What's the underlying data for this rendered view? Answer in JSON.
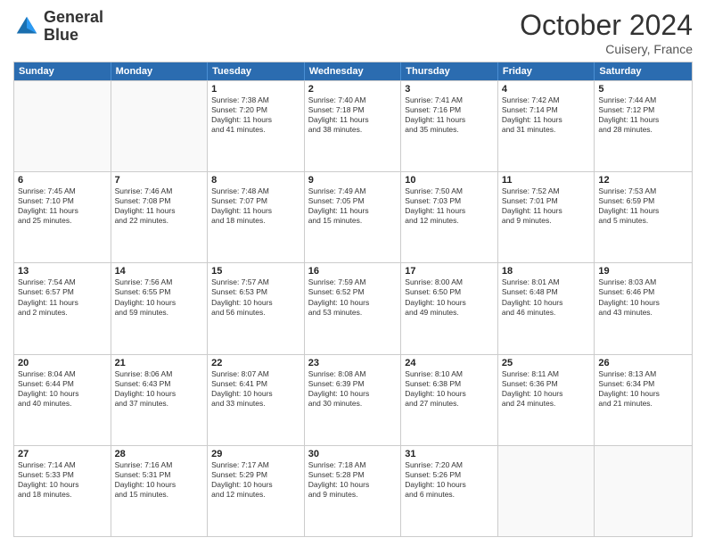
{
  "header": {
    "logo_line1": "General",
    "logo_line2": "Blue",
    "month": "October 2024",
    "location": "Cuisery, France"
  },
  "days_of_week": [
    "Sunday",
    "Monday",
    "Tuesday",
    "Wednesday",
    "Thursday",
    "Friday",
    "Saturday"
  ],
  "weeks": [
    [
      {
        "day": "",
        "lines": []
      },
      {
        "day": "",
        "lines": []
      },
      {
        "day": "1",
        "lines": [
          "Sunrise: 7:38 AM",
          "Sunset: 7:20 PM",
          "Daylight: 11 hours",
          "and 41 minutes."
        ]
      },
      {
        "day": "2",
        "lines": [
          "Sunrise: 7:40 AM",
          "Sunset: 7:18 PM",
          "Daylight: 11 hours",
          "and 38 minutes."
        ]
      },
      {
        "day": "3",
        "lines": [
          "Sunrise: 7:41 AM",
          "Sunset: 7:16 PM",
          "Daylight: 11 hours",
          "and 35 minutes."
        ]
      },
      {
        "day": "4",
        "lines": [
          "Sunrise: 7:42 AM",
          "Sunset: 7:14 PM",
          "Daylight: 11 hours",
          "and 31 minutes."
        ]
      },
      {
        "day": "5",
        "lines": [
          "Sunrise: 7:44 AM",
          "Sunset: 7:12 PM",
          "Daylight: 11 hours",
          "and 28 minutes."
        ]
      }
    ],
    [
      {
        "day": "6",
        "lines": [
          "Sunrise: 7:45 AM",
          "Sunset: 7:10 PM",
          "Daylight: 11 hours",
          "and 25 minutes."
        ]
      },
      {
        "day": "7",
        "lines": [
          "Sunrise: 7:46 AM",
          "Sunset: 7:08 PM",
          "Daylight: 11 hours",
          "and 22 minutes."
        ]
      },
      {
        "day": "8",
        "lines": [
          "Sunrise: 7:48 AM",
          "Sunset: 7:07 PM",
          "Daylight: 11 hours",
          "and 18 minutes."
        ]
      },
      {
        "day": "9",
        "lines": [
          "Sunrise: 7:49 AM",
          "Sunset: 7:05 PM",
          "Daylight: 11 hours",
          "and 15 minutes."
        ]
      },
      {
        "day": "10",
        "lines": [
          "Sunrise: 7:50 AM",
          "Sunset: 7:03 PM",
          "Daylight: 11 hours",
          "and 12 minutes."
        ]
      },
      {
        "day": "11",
        "lines": [
          "Sunrise: 7:52 AM",
          "Sunset: 7:01 PM",
          "Daylight: 11 hours",
          "and 9 minutes."
        ]
      },
      {
        "day": "12",
        "lines": [
          "Sunrise: 7:53 AM",
          "Sunset: 6:59 PM",
          "Daylight: 11 hours",
          "and 5 minutes."
        ]
      }
    ],
    [
      {
        "day": "13",
        "lines": [
          "Sunrise: 7:54 AM",
          "Sunset: 6:57 PM",
          "Daylight: 11 hours",
          "and 2 minutes."
        ]
      },
      {
        "day": "14",
        "lines": [
          "Sunrise: 7:56 AM",
          "Sunset: 6:55 PM",
          "Daylight: 10 hours",
          "and 59 minutes."
        ]
      },
      {
        "day": "15",
        "lines": [
          "Sunrise: 7:57 AM",
          "Sunset: 6:53 PM",
          "Daylight: 10 hours",
          "and 56 minutes."
        ]
      },
      {
        "day": "16",
        "lines": [
          "Sunrise: 7:59 AM",
          "Sunset: 6:52 PM",
          "Daylight: 10 hours",
          "and 53 minutes."
        ]
      },
      {
        "day": "17",
        "lines": [
          "Sunrise: 8:00 AM",
          "Sunset: 6:50 PM",
          "Daylight: 10 hours",
          "and 49 minutes."
        ]
      },
      {
        "day": "18",
        "lines": [
          "Sunrise: 8:01 AM",
          "Sunset: 6:48 PM",
          "Daylight: 10 hours",
          "and 46 minutes."
        ]
      },
      {
        "day": "19",
        "lines": [
          "Sunrise: 8:03 AM",
          "Sunset: 6:46 PM",
          "Daylight: 10 hours",
          "and 43 minutes."
        ]
      }
    ],
    [
      {
        "day": "20",
        "lines": [
          "Sunrise: 8:04 AM",
          "Sunset: 6:44 PM",
          "Daylight: 10 hours",
          "and 40 minutes."
        ]
      },
      {
        "day": "21",
        "lines": [
          "Sunrise: 8:06 AM",
          "Sunset: 6:43 PM",
          "Daylight: 10 hours",
          "and 37 minutes."
        ]
      },
      {
        "day": "22",
        "lines": [
          "Sunrise: 8:07 AM",
          "Sunset: 6:41 PM",
          "Daylight: 10 hours",
          "and 33 minutes."
        ]
      },
      {
        "day": "23",
        "lines": [
          "Sunrise: 8:08 AM",
          "Sunset: 6:39 PM",
          "Daylight: 10 hours",
          "and 30 minutes."
        ]
      },
      {
        "day": "24",
        "lines": [
          "Sunrise: 8:10 AM",
          "Sunset: 6:38 PM",
          "Daylight: 10 hours",
          "and 27 minutes."
        ]
      },
      {
        "day": "25",
        "lines": [
          "Sunrise: 8:11 AM",
          "Sunset: 6:36 PM",
          "Daylight: 10 hours",
          "and 24 minutes."
        ]
      },
      {
        "day": "26",
        "lines": [
          "Sunrise: 8:13 AM",
          "Sunset: 6:34 PM",
          "Daylight: 10 hours",
          "and 21 minutes."
        ]
      }
    ],
    [
      {
        "day": "27",
        "lines": [
          "Sunrise: 7:14 AM",
          "Sunset: 5:33 PM",
          "Daylight: 10 hours",
          "and 18 minutes."
        ]
      },
      {
        "day": "28",
        "lines": [
          "Sunrise: 7:16 AM",
          "Sunset: 5:31 PM",
          "Daylight: 10 hours",
          "and 15 minutes."
        ]
      },
      {
        "day": "29",
        "lines": [
          "Sunrise: 7:17 AM",
          "Sunset: 5:29 PM",
          "Daylight: 10 hours",
          "and 12 minutes."
        ]
      },
      {
        "day": "30",
        "lines": [
          "Sunrise: 7:18 AM",
          "Sunset: 5:28 PM",
          "Daylight: 10 hours",
          "and 9 minutes."
        ]
      },
      {
        "day": "31",
        "lines": [
          "Sunrise: 7:20 AM",
          "Sunset: 5:26 PM",
          "Daylight: 10 hours",
          "and 6 minutes."
        ]
      },
      {
        "day": "",
        "lines": []
      },
      {
        "day": "",
        "lines": []
      }
    ]
  ]
}
